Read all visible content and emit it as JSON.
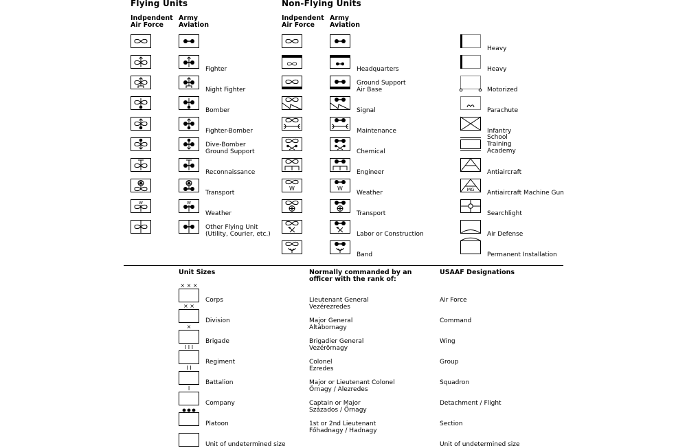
{
  "flying": {
    "title": "Flying Units",
    "col1": "Indpendent\nAir Force",
    "col2": "Army\nAviation",
    "rows": [
      {
        "label": "",
        "mod": "none"
      },
      {
        "label": "Fighter",
        "mod": "arrow-up"
      },
      {
        "label": "Night Fighter",
        "mod": "arrow-up-base"
      },
      {
        "label": "Bomber",
        "mod": "dot-down"
      },
      {
        "label": "Fighter-Bomber",
        "mod": "arrow-up-dot"
      },
      {
        "label": "Dive-Bomber\nGround Support",
        "mod": "dot-up-arrow-down"
      },
      {
        "label": "Reconnaissance",
        "mod": "t-bar"
      },
      {
        "label": "Transport",
        "mod": "wheel"
      },
      {
        "label": "Weather",
        "mod": "w"
      },
      {
        "label": "Other Flying Unit\n(Utility, Courier, etc.)",
        "mod": "line"
      }
    ]
  },
  "nonflying": {
    "title": "Non-Flying Units",
    "col1": "Indpendent\nAir Force",
    "col2": "Army\nAviation",
    "rows": [
      {
        "label": "",
        "mod": "none"
      },
      {
        "label": "Headquarters",
        "mod": "hq"
      },
      {
        "label": "Ground Support\nAir Base",
        "mod": "base"
      },
      {
        "label": "Signal",
        "mod": "signal"
      },
      {
        "label": "Maintenance",
        "mod": "maint"
      },
      {
        "label": "Chemical",
        "mod": "chem"
      },
      {
        "label": "Engineer",
        "mod": "eng"
      },
      {
        "label": "Weather",
        "mod": "w"
      },
      {
        "label": "Transport",
        "mod": "wheel"
      },
      {
        "label": "Labor or Construction",
        "mod": "labor"
      },
      {
        "label": "Band",
        "mod": "band"
      }
    ]
  },
  "modifiers": [
    {
      "label": "Heavy",
      "mod": "heavy1"
    },
    {
      "label": "Heavy",
      "mod": "heavy2"
    },
    {
      "label": "Motorized",
      "mod": "motor"
    },
    {
      "label": "Parachute",
      "mod": "para"
    },
    {
      "label": "Infantry",
      "mod": "inf"
    },
    {
      "label": "School\nTraining\nAcademy",
      "mod": "school"
    },
    {
      "label": "Antiaircraft",
      "mod": "aa"
    },
    {
      "label": "Antiaircraft Machine Gun",
      "mod": "aamg",
      "text": "MG"
    },
    {
      "label": "Searchlight",
      "mod": "search"
    },
    {
      "label": "Air Defense",
      "mod": "airdef"
    },
    {
      "label": "Permanent Installation",
      "mod": "perm"
    }
  ],
  "sizes": {
    "head_sizes": "Unit Sizes",
    "head_rank": "Normally commanded by an\nofficer with the rank of:",
    "head_usaaf": "USAAF Designations",
    "rows": [
      {
        "mark": "× × ×",
        "unit": "Corps",
        "rank": "Lieutenant General\nVezérezredes",
        "usaaf": "Air Force"
      },
      {
        "mark": "× ×",
        "unit": "Division",
        "rank": "Major General\nAltábornagy",
        "usaaf": "Command"
      },
      {
        "mark": "×",
        "unit": "Brigade",
        "rank": "Brigadier General\nVezérörnagy",
        "usaaf": "Wing"
      },
      {
        "mark": "I I I",
        "unit": "Regiment",
        "rank": "Colonel\nEzredes",
        "usaaf": "Group"
      },
      {
        "mark": "I I",
        "unit": "Battalion",
        "rank": "Major or Lieutenant Colonel\nŐrnagy / Alezredes",
        "usaaf": "Squadron"
      },
      {
        "mark": "I",
        "unit": "Company",
        "rank": "Captain or Major\nSzázados / Őrnagy",
        "usaaf": "Detachment / Flight"
      },
      {
        "mark": "dots",
        "unit": "Platoon",
        "rank": "1st or 2nd Lieutenant\nFőhadnagy / Hadnagy",
        "usaaf": "Section"
      },
      {
        "mark": "",
        "unit": "Unit of undetermined size",
        "rank": "",
        "usaaf": "Unit of undetermined size"
      }
    ]
  }
}
